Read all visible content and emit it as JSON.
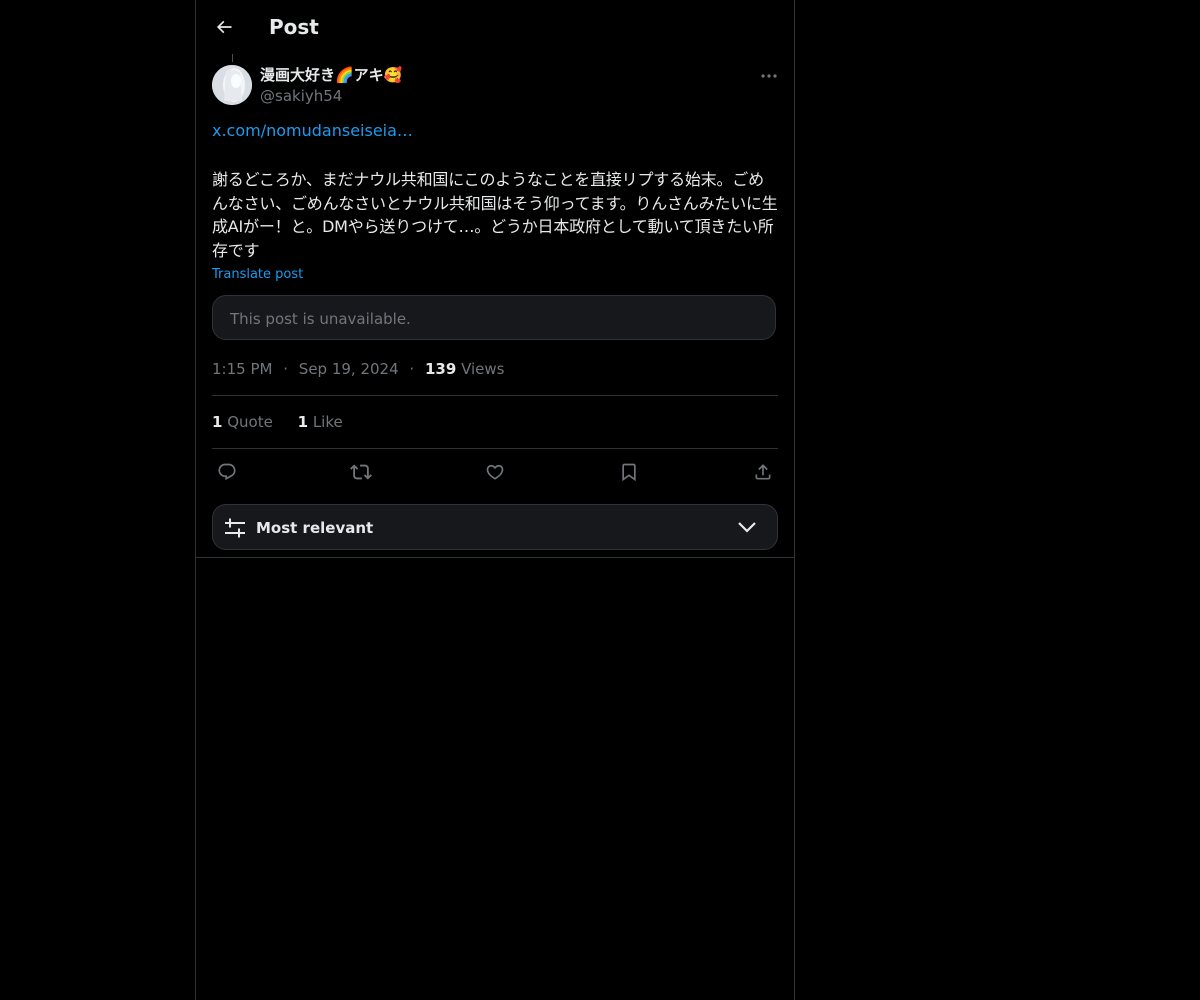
{
  "header": {
    "title": "Post"
  },
  "author": {
    "name": "漫画大好き🌈アキ🥰",
    "handle": "@sakiyh54"
  },
  "post": {
    "link": "x.com/nomudanseiseia…",
    "text": "謝るどころか、まだナウル共和国にこのようなことを直接リプする始末。ごめんなさい、ごめんなさいとナウル共和国はそう仰ってます。りんさんみたいに生成AIがー！と。DMやら送りつけて…。どうか日本政府として動いて頂きたい所存です",
    "translate_label": "Translate post",
    "embedded_unavailable": "This post is unavailable."
  },
  "meta": {
    "time": "1:15 PM",
    "date": "Sep 19, 2024",
    "views_count": "139",
    "views_label": "Views",
    "separator": "·"
  },
  "stats": {
    "quotes_count": "1",
    "quotes_label": "Quote",
    "likes_count": "1",
    "likes_label": "Like"
  },
  "actions": [
    "reply-icon",
    "repost-icon",
    "like-icon",
    "bookmark-icon",
    "share-icon"
  ],
  "sort": {
    "label": "Most relevant"
  },
  "colors": {
    "accent": "#1d9bf0",
    "muted": "#71767b",
    "text": "#e7e9ea",
    "border": "#2f3336",
    "background": "#000000"
  }
}
